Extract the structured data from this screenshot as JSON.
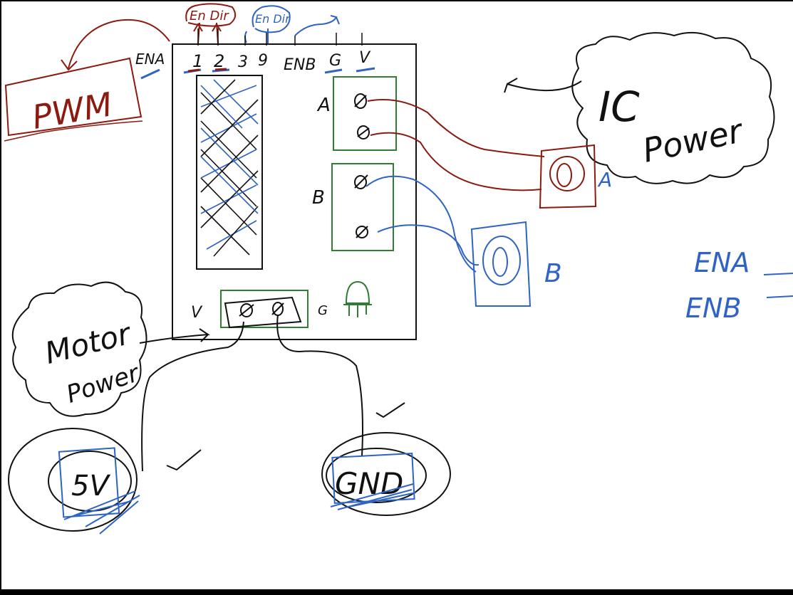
{
  "top_annotations": {
    "red_note": "En Dir",
    "blue_note": "En Dir"
  },
  "board": {
    "ena_label": "ENA",
    "pins": [
      "1",
      "2",
      "3",
      "9"
    ],
    "enb_label": "ENB",
    "ground_label": "G",
    "voltage_label": "V",
    "motor_a_label": "A",
    "motor_b_label": "B",
    "power_v_label": "V",
    "power_g_label": "G"
  },
  "pwm_box": {
    "label": "PWM"
  },
  "ic_power_cloud": {
    "label_line1": "IC",
    "label_line2": "Power"
  },
  "motor_power_cloud": {
    "label_line1": "Motor",
    "label_line2": "Power"
  },
  "motor_a": {
    "label": "A"
  },
  "motor_b": {
    "label": "B"
  },
  "supply_5v": {
    "label": "5V"
  },
  "ground_node": {
    "label": "GND"
  },
  "legend": {
    "ena": "ENA",
    "enb": "ENB"
  },
  "colors": {
    "ink_black": "#111111",
    "ink_red": "#8b1a10",
    "ink_blue": "#2f63c4",
    "ink_green": "#2e7d32",
    "background": "#ffffff"
  }
}
